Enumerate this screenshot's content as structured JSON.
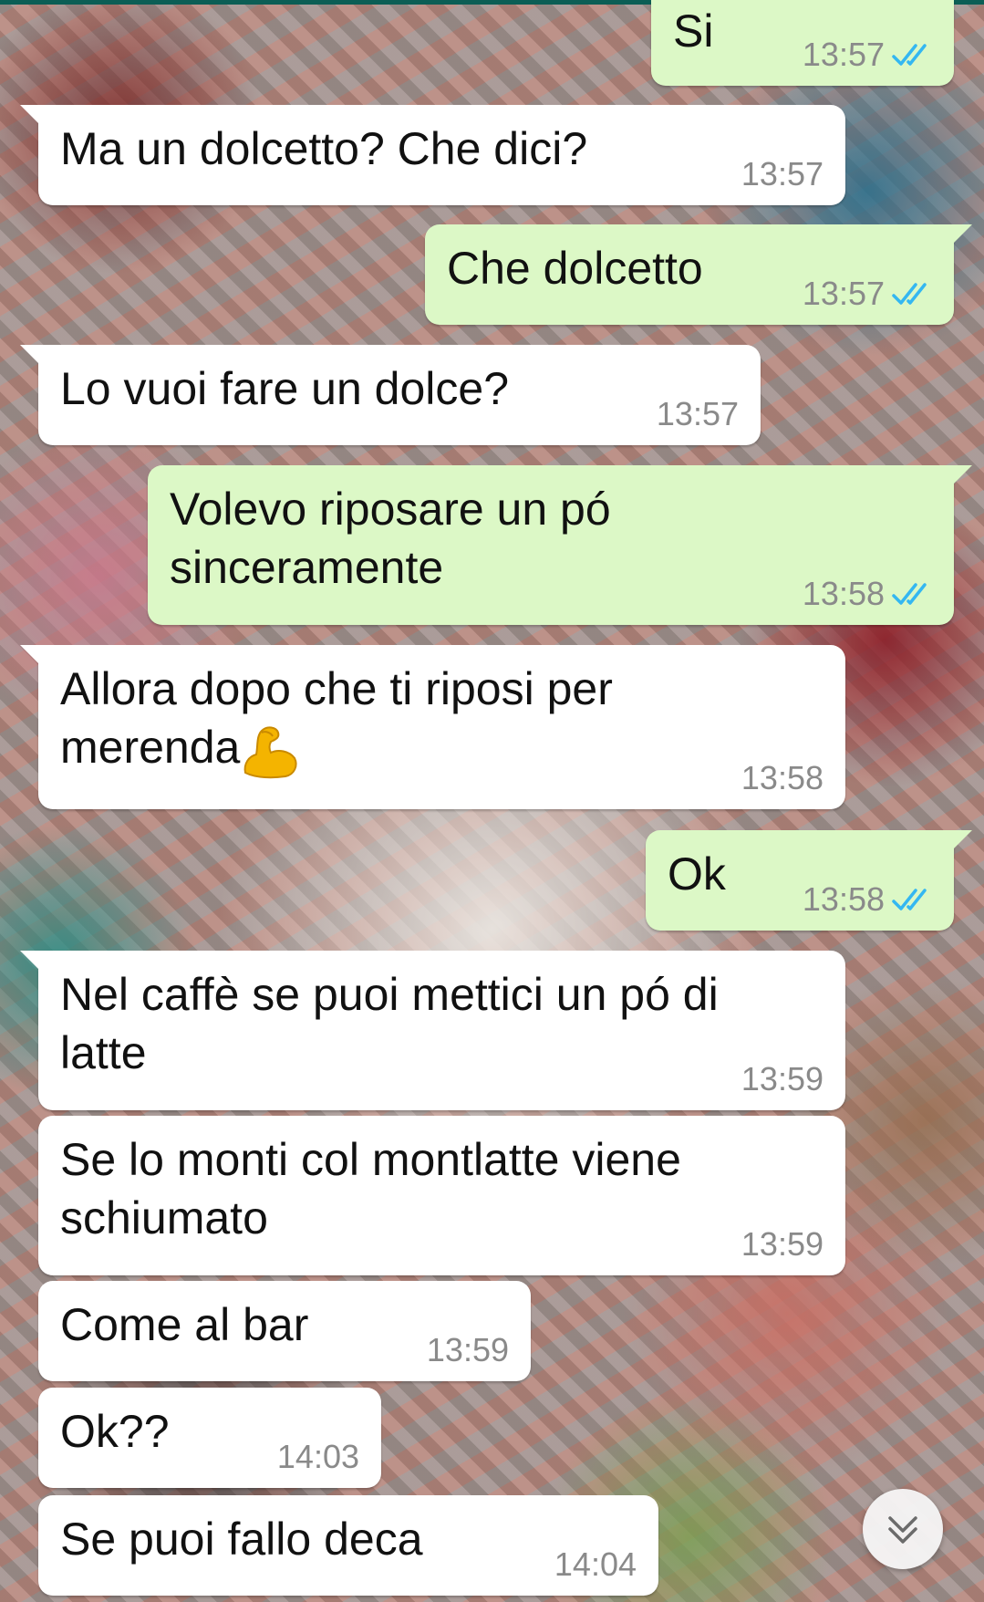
{
  "colors": {
    "incoming_bubble": "#ffffff",
    "outgoing_bubble": "#dcf8c6",
    "read_ticks": "#34b7f1",
    "timestamp": "#8a8a8a"
  },
  "messages": [
    {
      "direction": "outgoing",
      "text": "Si",
      "time": "13:57",
      "status": "read",
      "status_icon": "double-check-icon"
    },
    {
      "direction": "incoming",
      "text": "Ma un dolcetto? Che dici?",
      "time": "13:57"
    },
    {
      "direction": "outgoing",
      "text": "Che dolcetto",
      "time": "13:57",
      "status": "read",
      "status_icon": "double-check-icon"
    },
    {
      "direction": "incoming",
      "text": "Lo vuoi fare un dolce?",
      "time": "13:57"
    },
    {
      "direction": "outgoing",
      "text": "Volevo riposare un pó sinceramente",
      "time": "13:58",
      "status": "read",
      "status_icon": "double-check-icon"
    },
    {
      "direction": "incoming",
      "text": "Allora dopo che ti riposi per merenda",
      "emoji": "flexed-biceps-emoji",
      "time": "13:58"
    },
    {
      "direction": "outgoing",
      "text": "Ok",
      "time": "13:58",
      "status": "read",
      "status_icon": "double-check-icon"
    },
    {
      "direction": "incoming",
      "text": "Nel caffè se puoi mettici un pó di latte",
      "time": "13:59"
    },
    {
      "direction": "incoming",
      "text": "Se lo monti col montlatte viene schiumato",
      "time": "13:59"
    },
    {
      "direction": "incoming",
      "text": "Come al bar",
      "time": "13:59"
    },
    {
      "direction": "incoming",
      "text": "Ok??",
      "time": "14:03"
    },
    {
      "direction": "incoming",
      "text": "Se puoi fallo deca",
      "time": "14:04"
    }
  ],
  "scroll_button": {
    "icon": "double-chevron-down-icon"
  }
}
